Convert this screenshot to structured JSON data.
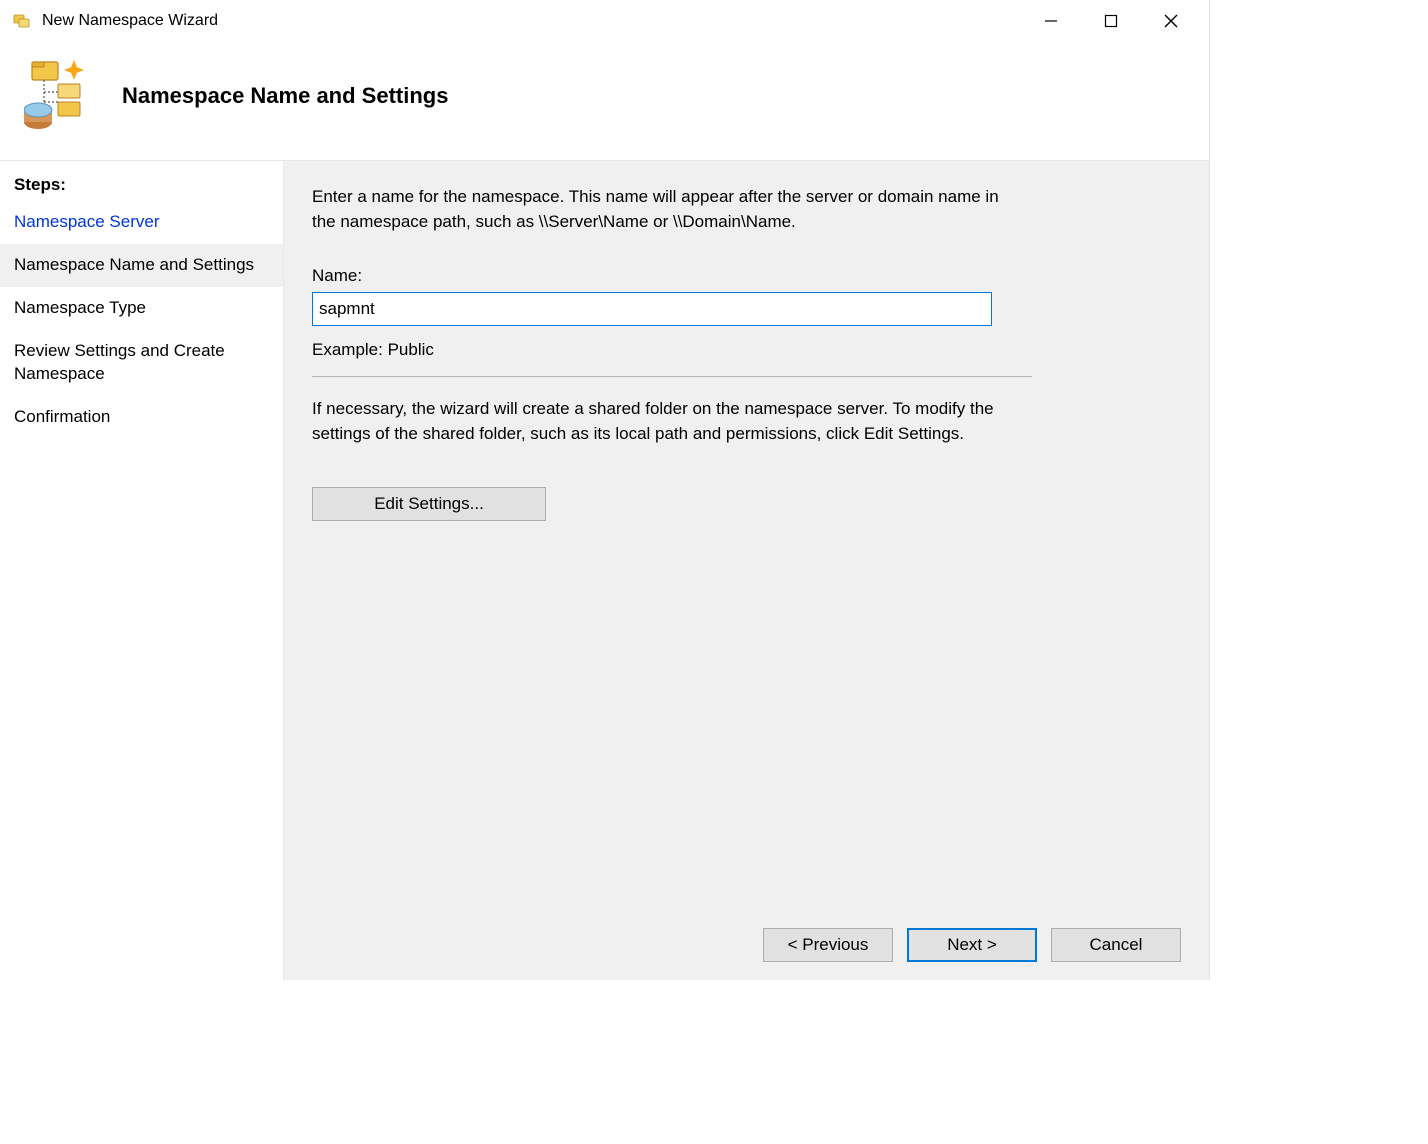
{
  "window": {
    "title": "New Namespace Wizard"
  },
  "header": {
    "title": "Namespace Name and Settings"
  },
  "sidebar": {
    "heading": "Steps:",
    "items": [
      {
        "label": "Namespace Server",
        "state": "completed"
      },
      {
        "label": "Namespace Name and Settings",
        "state": "current"
      },
      {
        "label": "Namespace Type",
        "state": "upcoming"
      },
      {
        "label": "Review Settings and Create Namespace",
        "state": "upcoming"
      },
      {
        "label": "Confirmation",
        "state": "upcoming"
      }
    ]
  },
  "main": {
    "intro": "Enter a name for the namespace. This name will appear after the server or domain name in the namespace path, such as \\\\Server\\Name or \\\\Domain\\Name.",
    "name_label": "Name:",
    "name_value": "sapmnt",
    "example": "Example: Public",
    "info": "If necessary, the wizard will create a shared folder on the namespace server. To modify the settings of the shared folder, such as its local path and permissions, click Edit Settings.",
    "edit_settings_label": "Edit Settings..."
  },
  "footer": {
    "previous": "< Previous",
    "next": "Next >",
    "cancel": "Cancel"
  }
}
